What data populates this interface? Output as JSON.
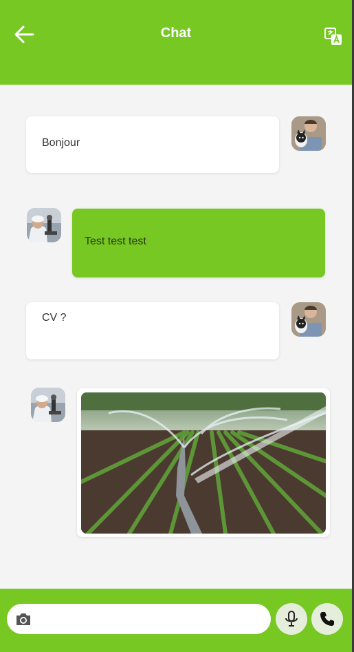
{
  "header": {
    "title": "Chat",
    "back_icon": "arrow-left-icon",
    "translate_icon": "translate-icon"
  },
  "messages": [
    {
      "text": "Bonjour",
      "side": "right-avatar",
      "style": "white",
      "avatar": "man-with-dog-avatar"
    },
    {
      "text": "Test test test",
      "side": "left-avatar",
      "style": "green",
      "avatar": "lab-technician-avatar"
    },
    {
      "text": "CV ?",
      "side": "right-avatar",
      "style": "white",
      "avatar": "man-with-dog-avatar"
    },
    {
      "type": "image",
      "image": "irrigation-field-photo",
      "side": "left-avatar",
      "avatar": "lab-technician-avatar"
    }
  ],
  "composer": {
    "value": "",
    "camera_icon": "camera-icon",
    "mic_icon": "microphone-icon",
    "call_icon": "phone-icon"
  },
  "colors": {
    "accent": "#77c823",
    "background": "#f4f4f4",
    "bubble_white": "#ffffff"
  }
}
